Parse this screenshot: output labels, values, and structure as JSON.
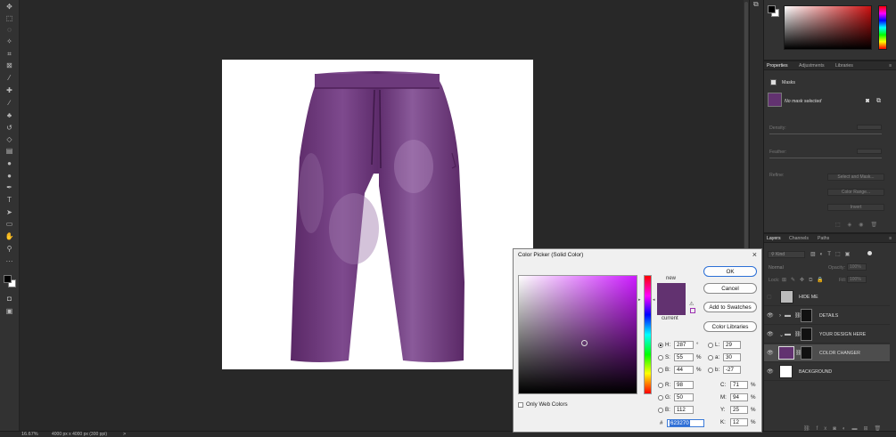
{
  "status": {
    "zoom": "16.67%",
    "doc_info": "4000 px x 4000 px (300 ppi)",
    "arrow": ">"
  },
  "tools": [
    {
      "name": "move-tool-icon",
      "glyph": "✥"
    },
    {
      "name": "marquee-tool-icon",
      "glyph": "⬚"
    },
    {
      "name": "lasso-tool-icon",
      "glyph": "◌"
    },
    {
      "name": "magic-wand-tool-icon",
      "glyph": "✧"
    },
    {
      "name": "crop-tool-icon",
      "glyph": "⌗"
    },
    {
      "name": "frame-tool-icon",
      "glyph": "⊠"
    },
    {
      "name": "eyedropper-tool-icon",
      "glyph": "⁄"
    },
    {
      "name": "healing-brush-tool-icon",
      "glyph": "✚"
    },
    {
      "name": "brush-tool-icon",
      "glyph": "∕"
    },
    {
      "name": "stamp-tool-icon",
      "glyph": "♣"
    },
    {
      "name": "history-brush-tool-icon",
      "glyph": "↺"
    },
    {
      "name": "eraser-tool-icon",
      "glyph": "◇"
    },
    {
      "name": "gradient-tool-icon",
      "glyph": "▤"
    },
    {
      "name": "blur-tool-icon",
      "glyph": "●"
    },
    {
      "name": "dodge-tool-icon",
      "glyph": "●"
    },
    {
      "name": "pen-tool-icon",
      "glyph": "✒"
    },
    {
      "name": "type-tool-icon",
      "glyph": "T"
    },
    {
      "name": "path-selection-tool-icon",
      "glyph": "➤"
    },
    {
      "name": "rectangle-tool-icon",
      "glyph": "▭"
    },
    {
      "name": "hand-tool-icon",
      "glyph": "✋"
    },
    {
      "name": "zoom-tool-icon",
      "glyph": "⚲"
    },
    {
      "name": "more-tools-icon",
      "glyph": "···"
    }
  ],
  "color_panel": {
    "hue_fill": "#cc1010"
  },
  "properties": {
    "tabs": [
      "Properties",
      "Adjustments",
      "Libraries"
    ],
    "section": "Masks",
    "mask_status": "No mask selected",
    "density_label": "Density:",
    "feather_label": "Feather:",
    "refine_label": "Refine:",
    "buttons": [
      "Select and Mask...",
      "Color Range...",
      "Invert"
    ]
  },
  "layers": {
    "tabs": [
      "Layers",
      "Channels",
      "Paths"
    ],
    "kind_label": "Kind",
    "blend_mode": "Normal",
    "opacity_label": "Opacity:",
    "opacity_value": "100%",
    "lock_label": "Lock:",
    "fill_label": "Fill:",
    "fill_value": "100%",
    "items": [
      {
        "name": "HIDE ME",
        "visible": false
      },
      {
        "name": "DETAILS",
        "visible": true
      },
      {
        "name": "YOUR DESIGN HERE",
        "visible": true
      },
      {
        "name": "COLOR CHANGER",
        "visible": true,
        "selected": true
      },
      {
        "name": "BACKGROUND",
        "visible": true
      }
    ]
  },
  "dialog": {
    "title": "Color Picker (Solid Color)",
    "new_label": "new",
    "current_label": "current",
    "new_color": "#623270",
    "current_color": "#623270",
    "buttons": {
      "ok": "OK",
      "cancel": "Cancel",
      "add_swatches": "Add to Swatches",
      "color_libraries": "Color Libraries"
    },
    "only_web_colors": "Only Web Colors",
    "hsb": [
      {
        "label": "H:",
        "value": "287",
        "unit": "°"
      },
      {
        "label": "S:",
        "value": "55",
        "unit": "%"
      },
      {
        "label": "B:",
        "value": "44",
        "unit": "%"
      }
    ],
    "rgb": [
      {
        "label": "R:",
        "value": "98"
      },
      {
        "label": "G:",
        "value": "50"
      },
      {
        "label": "B:",
        "value": "112"
      }
    ],
    "lab": [
      {
        "label": "L:",
        "value": "29"
      },
      {
        "label": "a:",
        "value": "30"
      },
      {
        "label": "b:",
        "value": "-27"
      }
    ],
    "cmyk": [
      {
        "label": "C:",
        "value": "71",
        "unit": "%"
      },
      {
        "label": "M:",
        "value": "94",
        "unit": "%"
      },
      {
        "label": "Y:",
        "value": "25",
        "unit": "%"
      },
      {
        "label": "K:",
        "value": "12",
        "unit": "%"
      }
    ],
    "hex_label": "#",
    "hex_value": "623270"
  }
}
